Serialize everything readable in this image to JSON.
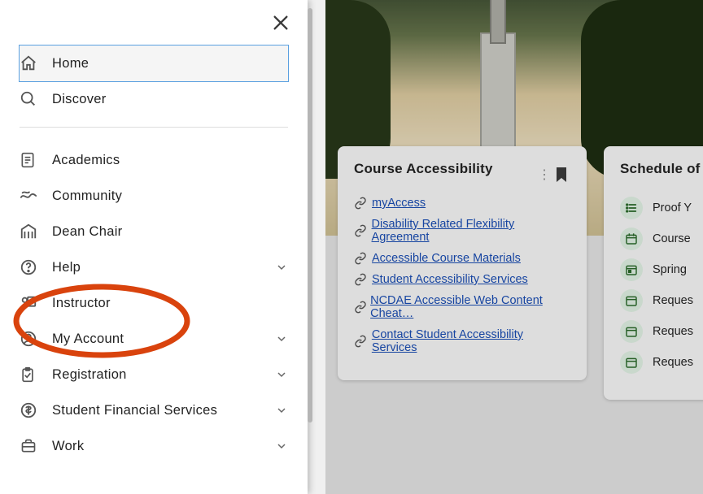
{
  "sidebar": {
    "primary": [
      {
        "key": "home",
        "label": "Home",
        "selected": true
      },
      {
        "key": "discover",
        "label": "Discover"
      }
    ],
    "items": [
      {
        "key": "academics",
        "label": "Academics",
        "expand": false
      },
      {
        "key": "community",
        "label": "Community",
        "expand": false
      },
      {
        "key": "deanchair",
        "label": "Dean Chair",
        "expand": false
      },
      {
        "key": "help",
        "label": "Help",
        "expand": true
      },
      {
        "key": "instructor",
        "label": "Instructor",
        "expand": false
      },
      {
        "key": "myaccount",
        "label": "My Account",
        "expand": true
      },
      {
        "key": "registration",
        "label": "Registration",
        "expand": true
      },
      {
        "key": "sfs",
        "label": "Student Financial Services",
        "expand": true
      },
      {
        "key": "work",
        "label": "Work",
        "expand": true
      }
    ]
  },
  "cards": {
    "accessibility": {
      "title": "Course Accessibility",
      "links": [
        "myAccess",
        "Disability Related Flexibility Agreement",
        "Accessible Course Materials",
        "Student Accessibility Services",
        "NCDAE Accessible Web Content Cheat…",
        "Contact Student Accessibility Services"
      ]
    },
    "schedule": {
      "title": "Schedule of",
      "items": [
        {
          "icon": "list",
          "label": "Proof Y"
        },
        {
          "icon": "cal",
          "label": "Course"
        },
        {
          "icon": "cal2",
          "label": "Spring "
        },
        {
          "icon": "cal",
          "label": "Reques"
        },
        {
          "icon": "cal",
          "label": "Reques"
        },
        {
          "icon": "cal",
          "label": "Reques"
        }
      ]
    }
  }
}
